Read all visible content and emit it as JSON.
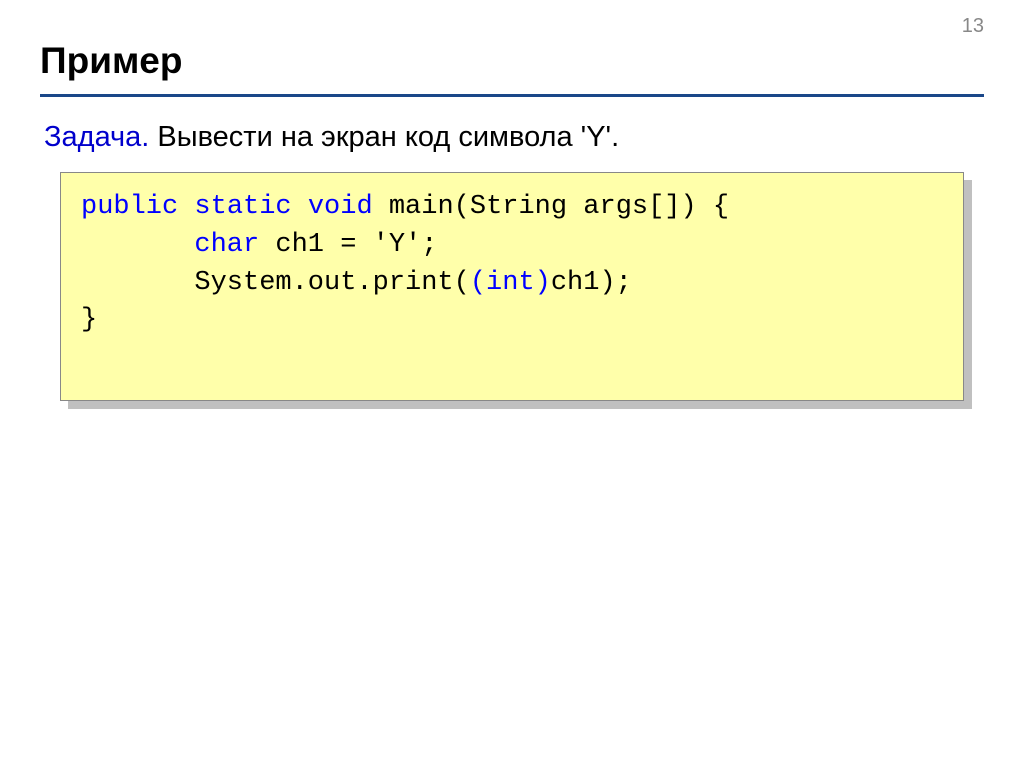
{
  "page_number": "13",
  "title": "Пример",
  "task": {
    "label": "Задача.",
    "text": " Вывести на экран код символа 'Y'."
  },
  "code": {
    "line1_pre": "public static void",
    "line1_post": " main(String args[]) {",
    "line2_pre": "char",
    "line2_post": " ch1 = 'Y';",
    "line3_pre": "System.out.print(",
    "line3_mid": "(int)",
    "line3_post": "ch1);",
    "line4": "}"
  }
}
